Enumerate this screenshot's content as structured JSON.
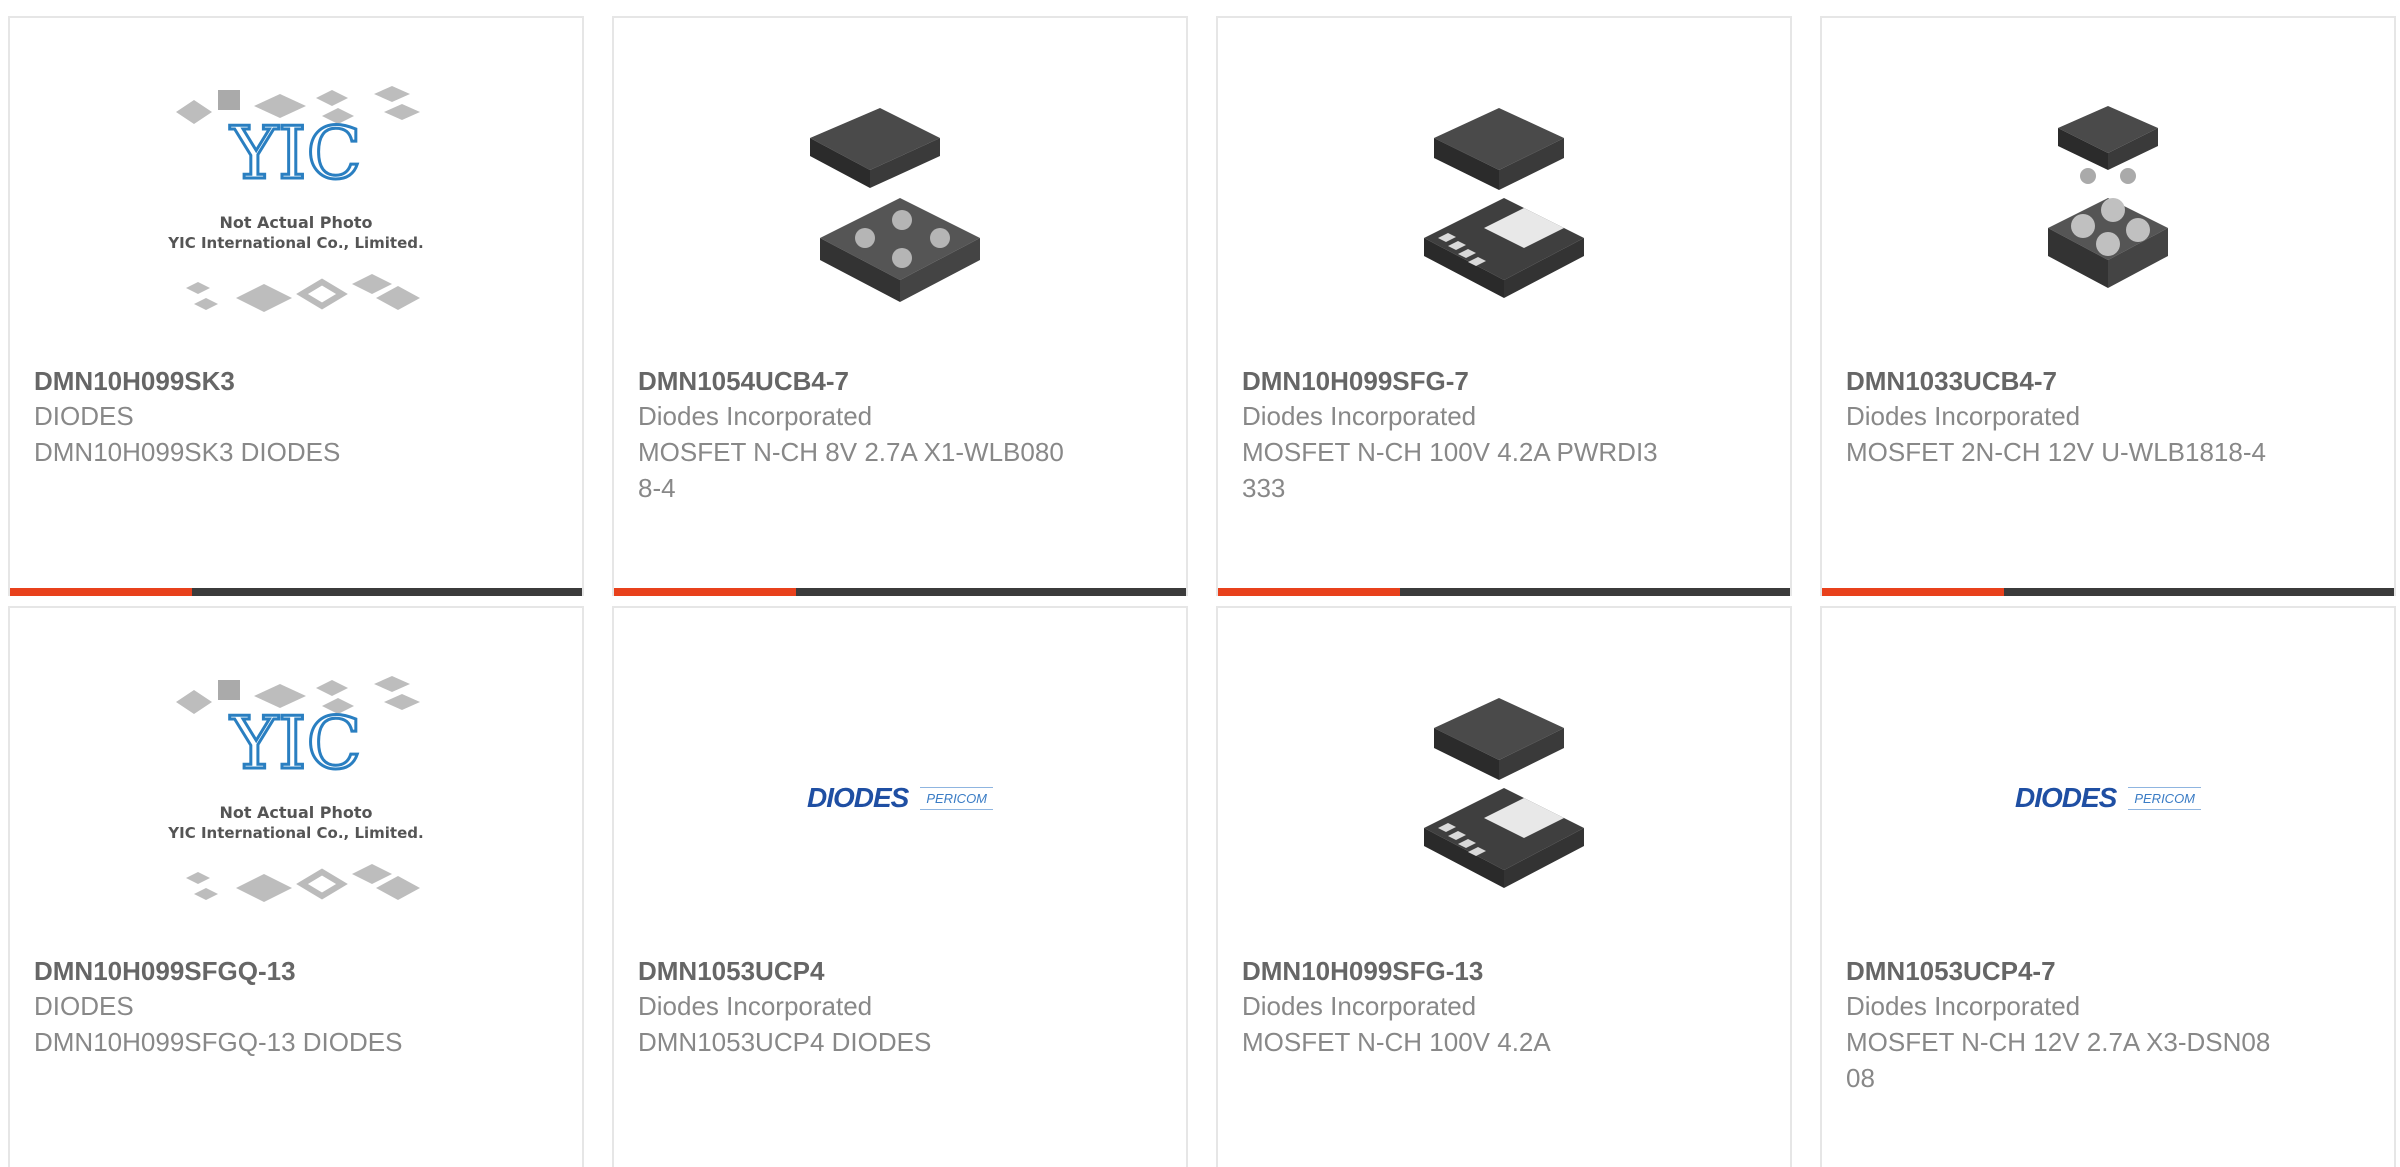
{
  "products": [
    {
      "part_number": "DMN10H099SK3",
      "manufacturer": "DIODES",
      "description": "DMN10H099SK3 DIODES",
      "image": "yic-placeholder",
      "placeholder": {
        "line1": "Not Actual Photo",
        "line2": "YIC International Co., Limited.",
        "logo": "YIC"
      }
    },
    {
      "part_number": "DMN1054UCB4-7",
      "manufacturer": "Diodes Incorporated",
      "description": "MOSFET N-CH 8V 2.7A X1-WLB0808-4",
      "image": "chip-wlb-4ball"
    },
    {
      "part_number": "DMN10H099SFG-7",
      "manufacturer": "Diodes Incorporated",
      "description": "MOSFET N-CH 100V 4.2A PWRDI3333",
      "image": "chip-powerdi-8pad"
    },
    {
      "part_number": "DMN1033UCB4-7",
      "manufacturer": "Diodes Incorporated",
      "description": "MOSFET 2N-CH 12V U-WLB1818-4",
      "image": "chip-wlb-4ball-tall"
    },
    {
      "part_number": "DMN10H099SFGQ-13",
      "manufacturer": "DIODES",
      "description": "DMN10H099SFGQ-13 DIODES",
      "image": "yic-placeholder",
      "placeholder": {
        "line1": "Not Actual Photo",
        "line2": "YIC International Co., Limited.",
        "logo": "YIC"
      }
    },
    {
      "part_number": "DMN1053UCP4",
      "manufacturer": "Diodes Incorporated",
      "description": "DMN1053UCP4 DIODES",
      "image": "diodes-logo",
      "logo": {
        "brand": "DIODES",
        "partner": "PERICOM"
      }
    },
    {
      "part_number": "DMN10H099SFG-13",
      "manufacturer": "Diodes Incorporated",
      "description": "MOSFET N-CH 100V 4.2A",
      "image": "chip-powerdi-8pad"
    },
    {
      "part_number": "DMN1053UCP4-7",
      "manufacturer": "Diodes Incorporated",
      "description": "MOSFET N-CH 12V 2.7A X3-DSN0808",
      "image": "diodes-logo",
      "logo": {
        "brand": "DIODES",
        "partner": "PERICOM"
      }
    }
  ],
  "colors": {
    "accent": "#e8411c",
    "bar": "#3b3b3b",
    "part_number": "#666666",
    "text": "#888888",
    "yic_blue": "#2a7fc1"
  }
}
